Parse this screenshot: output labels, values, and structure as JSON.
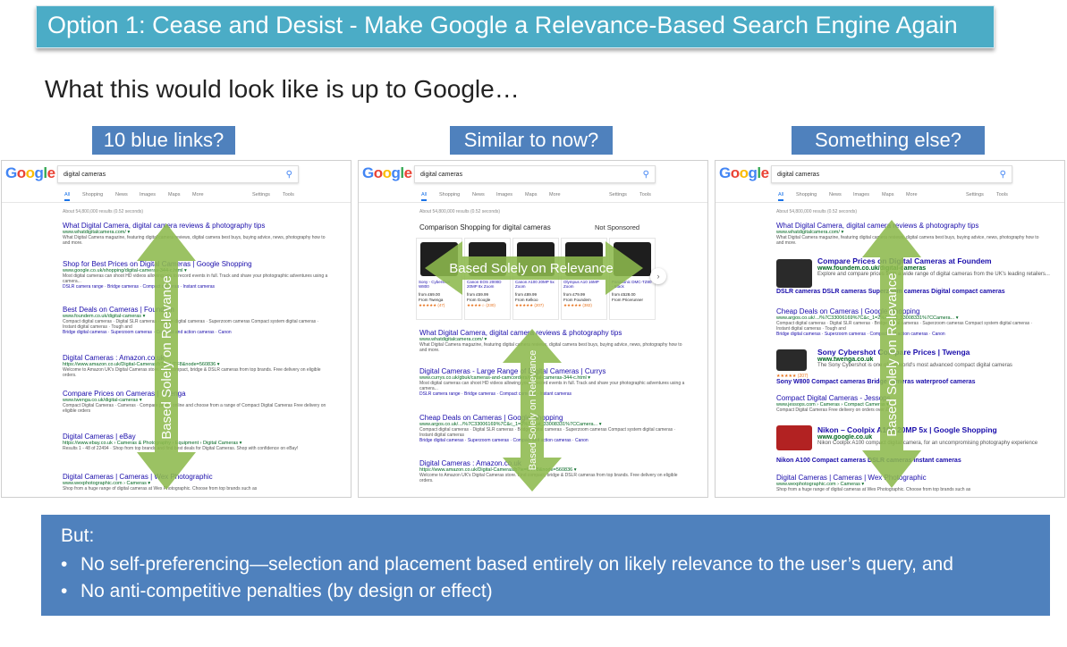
{
  "title": "Option 1: Cease and Desist - Make Google a Relevance-Based Search Engine Again",
  "subtitle": "What this would look like is up to Google…",
  "options": [
    {
      "label": "10 blue links?"
    },
    {
      "label": "Similar to now?"
    },
    {
      "label": "Something else?"
    }
  ],
  "arrow_label": "Based Solely on Relevance",
  "serp": {
    "logo": "Google",
    "query": "digital cameras",
    "tabs": [
      "All",
      "Shopping",
      "News",
      "Images",
      "Maps",
      "More",
      "Settings",
      "Tools"
    ],
    "stats": "About 54,800,000 results (0.52 seconds)",
    "shopping_header": "Comparison Shopping for digital cameras",
    "not_sponsored": "Not Sponsored",
    "products": [
      {
        "name": "Sony - Cybershot W800",
        "price": "from £69.00",
        "seller": "From Twenga",
        "stars": "★★★★★ (47)"
      },
      {
        "name": "Canon EOS 2000D 20MP 8x Zoom",
        "price": "from £59.99",
        "seller": "From Google",
        "stars": "★★★★☆ (230)"
      },
      {
        "name": "Canon A100 20MP 5x Zoom",
        "price": "from £89.99",
        "seller": "From Kelkoo",
        "stars": "★★★★★ (207)"
      },
      {
        "name": "Olympus A10 16MP Zoom",
        "price": "from £79.99",
        "seller": "From Foundem",
        "stars": "★★★★★ (382)"
      },
      {
        "name": "Panasonic DMC-TZ80 - Black",
        "price": "from £528.00",
        "seller": "From Pricerunner",
        "stars": ""
      }
    ],
    "results1": [
      {
        "t": "What Digital Camera, digital camera reviews & photography tips",
        "u": "www.whatdigitalcamera.com/ ▾",
        "d": "What Digital Camera magazine, featuring digital camera reviews, digital camera best buys, buying advice, news, photography how to and more."
      },
      {
        "t": "Shop for Best Prices on Digital Cameras | Google Shopping",
        "u": "www.google.co.uk/shopping/digital-cameras-344-c.html ▾",
        "d": "Most digital cameras can shoot HD videos allowing you to record events in full. Track and share your photographic adventures using a camera...",
        "sl": "DSLR camera range · Bridge cameras · Compact cameras · Instant cameras"
      },
      {
        "t": "Best Deals on Cameras | Foundem",
        "u": "www.foundem.co.uk/digital-cameras ▾",
        "d": "Compact digital cameras · Digital SLR cameras · Bridge digital cameras · Superzoom cameras Compact system digital cameras · Instant digital cameras · Tough and",
        "sl": "Bridge digital cameras · Superzoom cameras · Compact and action cameras · Canon"
      },
      {
        "t": "Digital Cameras : Amazon.co.uk",
        "u": "https://www.amazon.co.uk/Digital-Cameras/b?ie=UTF8&node=560836 ▾",
        "d": "Welcome to Amazon UK's Digital Cameras store. Find compact, bridge & DSLR cameras from top brands. Free delivery on eligible orders."
      },
      {
        "t": "Compare Prices on Cameras | Twenga",
        "u": "www.twenga.co.uk/digital-cameras ▾",
        "d": "Compact Digital Cameras · Cameras · Compare prices online and choose from a range of Compact Digital Cameras Free delivery on eligible orders"
      },
      {
        "t": "Digital Cameras | eBay",
        "u": "https://www.ebay.co.uk › Cameras & Photography › Equipment › Digital Cameras ▾",
        "d": "Results 1 - 48 of 22494 · Shop from top brands and find best deals for Digital Cameras. Shop with confidence on eBay!"
      },
      {
        "t": "Digital Cameras | Cameras | Wex Photographic",
        "u": "www.wexphotographic.com › Cameras ▾",
        "d": "Shop from a huge range of digital cameras at Wex Photographic. Choose from top brands such as"
      }
    ],
    "results2": [
      {
        "t": "What Digital Camera, digital camera reviews & photography tips",
        "u": "www.whatdigitalcamera.com/ ▾",
        "d": "What Digital Camera magazine, featuring digital camera reviews, digital camera best buys, buying advice, news, photography how to and more."
      },
      {
        "t": "Digital Cameras - Large Range of Digital Cameras | Currys",
        "u": "www.currys.co.uk/gbuk/cameras-and-camcorders/digital-cameras-344-c.html ▾",
        "d": "Most digital cameras can shoot HD videos allowing you to record events in full. Track and share your photographic adventures using a camera...",
        "sl": "DSLR camera range · Bridge cameras · Compact cameras · Instant cameras"
      },
      {
        "t": "Cheap Deals on Cameras | Google Shopping",
        "u": "www.argos.co.uk/.../%7C33006169%7C&c_1=2%7Ccat_33008331%7CCamera... ▾",
        "d": "Compact digital cameras · Digital SLR cameras · Bridge digital cameras · Superzoom cameras Compact system digital cameras · Instant digital cameras",
        "sl": "Bridge digital cameras · Superzoom cameras · Compact and action cameras · Canon"
      },
      {
        "t": "Digital Cameras : Amazon.co.uk",
        "u": "https://www.amazon.co.uk/Digital-Cameras/b?ie=UTF8&node=560836 ▾",
        "d": "Welcome to Amazon UK's Digital Cameras store. Find compact, bridge & DSLR cameras from top brands. Free delivery on eligible orders."
      }
    ],
    "results3": {
      "r1": {
        "t": "What Digital Camera, digital camera reviews & photography tips",
        "u": "www.whatdigitalcamera.com/ ▾",
        "d": "What Digital Camera magazine, featuring digital camera reviews, digital camera best buys, buying advice, news, photography how to and more."
      },
      "r2": {
        "t": "Compare Prices on Digital Cameras at Foundem",
        "u": "www.foundem.co.uk/digital-cameras",
        "d": "Explore and compare prices from a wide range of digital cameras from the UK's leading retailers...",
        "sl": "DSLR cameras  DSLR cameras  Superzoom cameras  Digital compact cameras"
      },
      "r3": {
        "t": "Cheap Deals on Cameras | Google Shopping",
        "u": "www.argos.co.uk/.../%7C33006169%7C&c_1=2%7Ccat_33008331%7CCamera... ▾",
        "d": "Compact digital cameras · Digital SLR cameras · Bridge digital cameras · Superzoom cameras Compact system digital cameras · Instant digital cameras · Tough and",
        "sl": "Bridge digital cameras · Superzoom cameras · Compact and action cameras · Canon"
      },
      "r4": {
        "t": "Sony Cybershot Compare Prices | Twenga",
        "u": "www.twenga.co.uk",
        "d": "The Sony Cybershot is one of the world's most advanced compact digital cameras",
        "stars": "★★★★★ (207)",
        "sl": "Sony W800  Compact cameras  Bridge cameras  waterproof cameras"
      },
      "r5": {
        "t": "Compact Digital Cameras - Jessops",
        "u": "www.jessops.com › Cameras › Compact Cameras ▾",
        "d": "Compact Digital Cameras Free delivery on orders over £50"
      },
      "r6": {
        "t": "Nikon – Coolpix A100 20MP 5x | Google Shopping",
        "u": "www.google.co.uk",
        "d": "Nikon Coolpix A100 compact digital camera, for an uncompromising photography experience",
        "sl": "Nikon A100  Compact cameras  DSLR cameras  Instant cameras"
      },
      "r7": {
        "t": "Digital Cameras | Cameras | Wex Photographic",
        "u": "www.wexphotographic.com › Cameras ▾",
        "d": "Shop from a huge range of digital cameras at Wex Photographic. Choose from top brands such as"
      }
    }
  },
  "but": {
    "heading": "But:",
    "bullet_glyph": "•",
    "bullets": [
      "No self-preferencing—selection and placement based entirely on likely relevance to the user’s query, and",
      "No anti-competitive penalties (by design or effect)"
    ]
  },
  "colors": {
    "title_bg": "#4bacc6",
    "label_bg": "#4f81bd",
    "arrow": "#8db94d",
    "but_bg": "#4f81bd"
  }
}
